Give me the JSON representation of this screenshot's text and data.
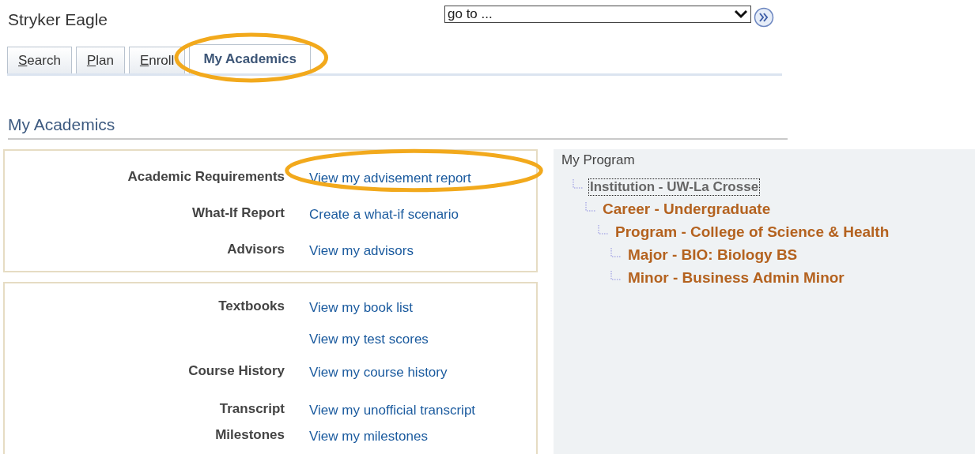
{
  "header": {
    "title": "Stryker Eagle",
    "goto": {
      "value": "go to ..."
    }
  },
  "tabs": [
    {
      "label": "Search",
      "selected": false,
      "circled": false
    },
    {
      "label": "Plan",
      "selected": false,
      "circled": false
    },
    {
      "label": "Enroll",
      "selected": false,
      "circled": false
    },
    {
      "label": "My Academics",
      "selected": true,
      "circled": true
    }
  ],
  "page_title": "My Academics",
  "panels": [
    {
      "rows": [
        {
          "label": "Academic Requirements",
          "link": "View my advisement report",
          "circled": true
        },
        {
          "label": "What-If Report",
          "link": "Create a what-if scenario",
          "circled": false
        },
        {
          "label": "Advisors",
          "link": "View my advisors",
          "circled": false
        }
      ]
    },
    {
      "rows": [
        {
          "label": "Textbooks",
          "link": "View my book list",
          "circled": false
        },
        {
          "link": "View my test scores",
          "circled": false
        },
        {
          "label": "Course History",
          "link": "View my course history",
          "circled": false
        },
        {
          "label": "Transcript",
          "link": "View my unofficial transcript",
          "circled": false
        },
        {
          "label": "Milestones",
          "link": "View my milestones",
          "circled": false
        }
      ]
    }
  ],
  "program": {
    "title": "My Program",
    "tree": [
      {
        "label": "Institution - UW-La Crosse",
        "selected": true,
        "children": [
          {
            "label": "Career - Undergraduate",
            "selected": false,
            "children": [
              {
                "label": "Program - College of Science & Health",
                "selected": false,
                "children": [
                  {
                    "label": "Major - BIO: Biology BS",
                    "selected": false
                  },
                  {
                    "label": "Minor - Business Admin Minor",
                    "selected": false
                  }
                ]
              }
            ]
          }
        ]
      }
    ]
  }
}
